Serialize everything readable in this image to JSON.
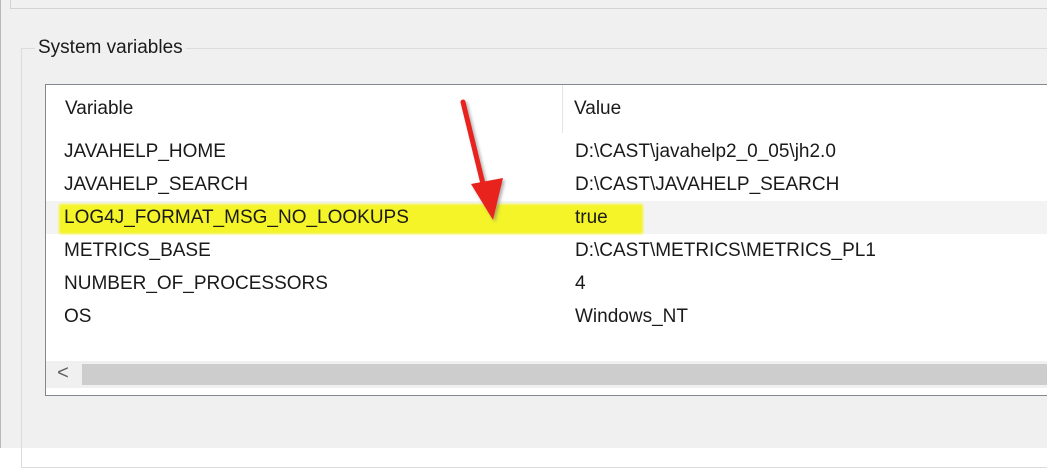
{
  "group": {
    "title": "System variables"
  },
  "table": {
    "columns": [
      "Variable",
      "Value"
    ],
    "rows": [
      {
        "variable": "JAVAHELP_HOME",
        "value": "D:\\CAST\\javahelp2_0_05\\jh2.0"
      },
      {
        "variable": "JAVAHELP_SEARCH",
        "value": "D:\\CAST\\JAVAHELP_SEARCH"
      },
      {
        "variable": "LOG4J_FORMAT_MSG_NO_LOOKUPS",
        "value": "true"
      },
      {
        "variable": "METRICS_BASE",
        "value": "D:\\CAST\\METRICS\\METRICS_PL1"
      },
      {
        "variable": "NUMBER_OF_PROCESSORS",
        "value": "4"
      },
      {
        "variable": "OS",
        "value": "Windows_NT"
      }
    ],
    "selected_row_index": 2
  },
  "scrollbar": {
    "left_arrow": "<"
  },
  "annotation": {
    "arrow_color": "#e8211b",
    "highlight_color": "#f5f51e"
  }
}
